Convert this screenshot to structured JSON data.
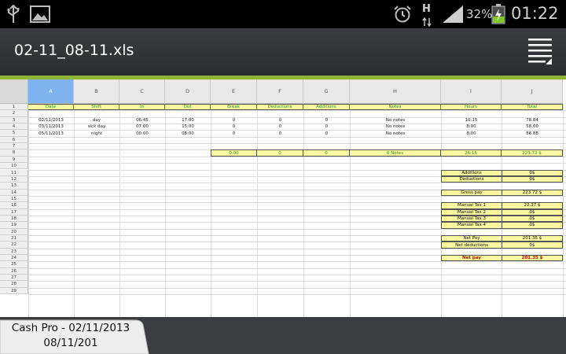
{
  "status_bar": {
    "icons": [
      "usb-icon",
      "image-icon",
      "alarm-icon",
      "data-transfer-icon",
      "signal-icon",
      "battery-charging-icon"
    ],
    "network_label": "H",
    "battery": "32%",
    "time": "01:22"
  },
  "app": {
    "file_name": "02-11_08-11.xls",
    "menu_icon": "menu-icon"
  },
  "sheet": {
    "columns": [
      "A",
      "B",
      "C",
      "D",
      "E",
      "F",
      "G",
      "H",
      "I",
      "J"
    ],
    "selected_column": "A",
    "row_numbers": [
      "1",
      "2",
      "3",
      "4",
      "5",
      "6",
      "7",
      "8",
      "9",
      "10",
      "11",
      "12",
      "13",
      "14",
      "15",
      "16",
      "17",
      "18",
      "19",
      "20",
      "21",
      "22",
      "23",
      "24",
      "25",
      "26",
      "27",
      "28",
      "29"
    ],
    "header_row": [
      "Date",
      "Shift",
      "In",
      "Out",
      "Break",
      "Deductions",
      "Additions",
      "Notes",
      "Hours",
      "Total"
    ],
    "records": [
      [
        "02/11/2013",
        "day",
        "06:45",
        "17:00",
        "0",
        "0",
        "0",
        "No notes",
        "10:15",
        "78.84"
      ],
      [
        "03/11/2013",
        "sick day",
        "07:00",
        "15:00",
        "0",
        "0",
        "0",
        "No notes",
        "8:00",
        "58.00"
      ],
      [
        "05/11/2013",
        "night",
        "00:00",
        "08:00",
        "0",
        "0",
        "0",
        "No notes",
        "8:00",
        "86.88"
      ]
    ],
    "totals": {
      "break": "0:00",
      "deductions": "0",
      "additions": "0",
      "notes": "0 Notes",
      "hours": "26:15",
      "total": "223.72 $"
    },
    "summary": [
      {
        "label": "Additions",
        "value": "0$",
        "row": 11
      },
      {
        "label": "Deductions",
        "value": "0$",
        "row": 12
      },
      {
        "label": "Gross pay",
        "value": "223.72 $",
        "row": 14
      },
      {
        "label": "Manual Tax 1",
        "value": "22.37 $",
        "row": 16
      },
      {
        "label": "Manual Tax 2",
        "value": "0$",
        "row": 17
      },
      {
        "label": "Manual Tax 3",
        "value": "0$",
        "row": 18
      },
      {
        "label": "Manual Tax 4",
        "value": "0$",
        "row": 19
      },
      {
        "label": "Net Pay",
        "value": "201.35 $",
        "row": 21
      },
      {
        "label": "Net deductions",
        "value": "0$",
        "row": 22
      },
      {
        "label": "Net pay",
        "value": "201.35 $",
        "row": 24,
        "highlight": "red"
      }
    ]
  },
  "sheet_tab": {
    "line1": "Cash Pro - 02/11/2013",
    "line2": "08/11/201"
  },
  "colors": {
    "accent_green": "#8fb339",
    "cell_yellow": "#f8f8a0",
    "header_text_green": "#2f8f1f",
    "selected_column_blue": "#7fb3f0",
    "net_pay_red": "#d40000"
  }
}
